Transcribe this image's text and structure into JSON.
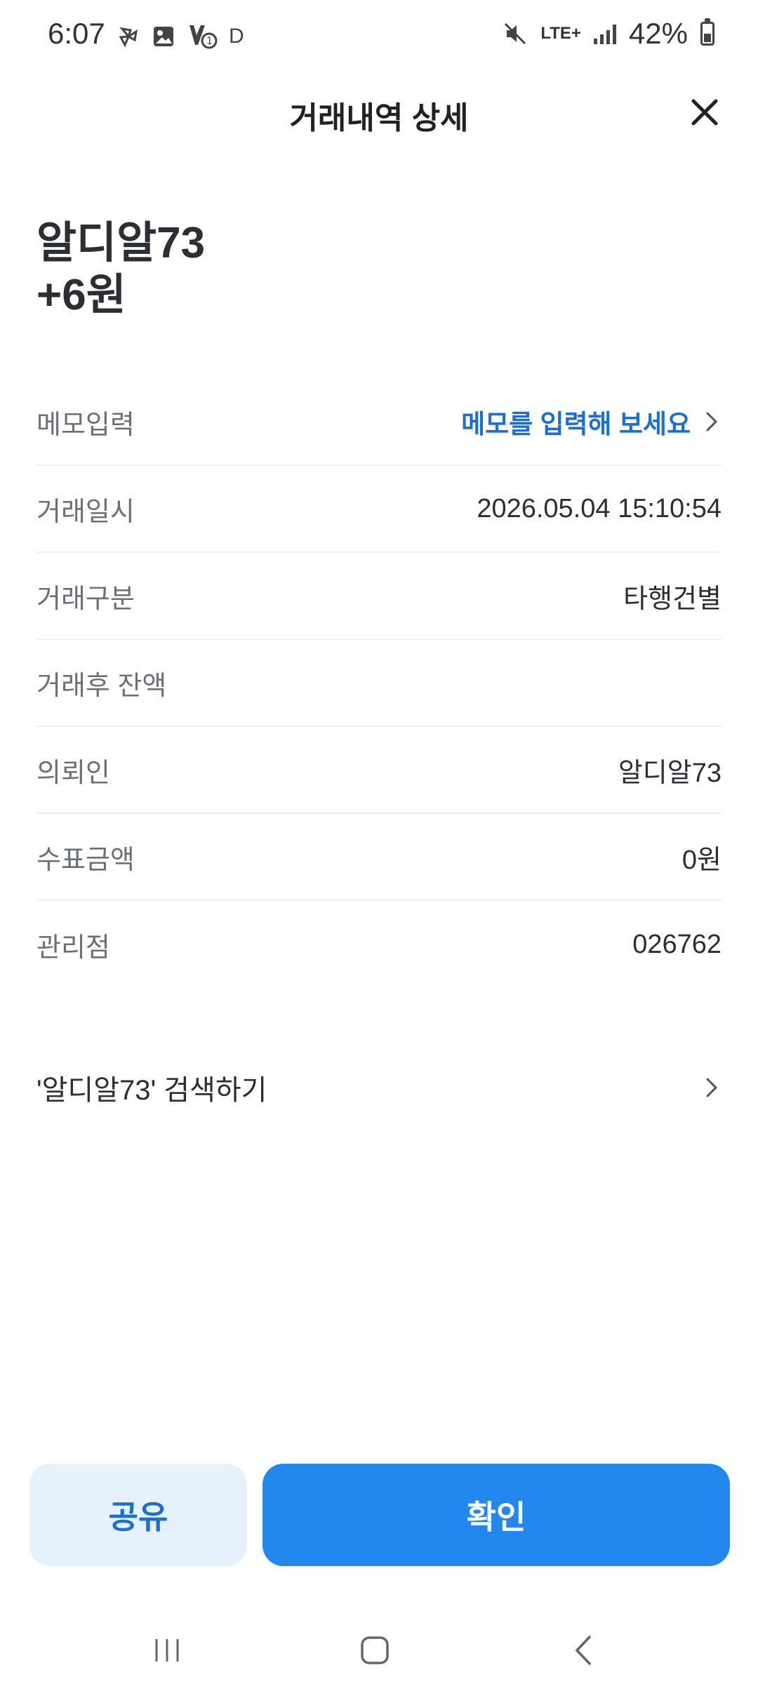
{
  "status_bar": {
    "time": "6:07",
    "notification_letter": "D",
    "network": "LTE+",
    "battery_percent": "42%",
    "icons": [
      "pinwheel-icon",
      "image-icon",
      "volte-icon",
      "mute-icon",
      "signal-icon",
      "battery-icon"
    ]
  },
  "header": {
    "title": "거래내역 상세",
    "close_icon": "close-icon"
  },
  "summary": {
    "name": "알디알73",
    "amount": "+6원"
  },
  "details": [
    {
      "label": "메모입력",
      "value": "메모를 입력해 보세요"
    },
    {
      "label": "거래일시",
      "value": "2026.05.04 15:10:54"
    },
    {
      "label": "거래구분",
      "value": "타행건별"
    },
    {
      "label": "거래후 잔액",
      "value": ""
    },
    {
      "label": "의뢰인",
      "value": "알디알73"
    },
    {
      "label": "수표금액",
      "value": "0원"
    },
    {
      "label": "관리점",
      "value": "026762"
    }
  ],
  "search": {
    "label": "'알디알73' 검색하기"
  },
  "buttons": {
    "share": "공유",
    "confirm": "확인"
  },
  "colors": {
    "accent_blue": "#2288ee",
    "link_blue": "#1c6fd1",
    "share_bg": "#e5f2fd"
  }
}
